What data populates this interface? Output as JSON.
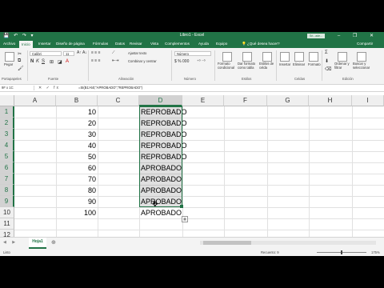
{
  "titlebar": {
    "quick_access": "💾 ↶ ↷ ▾",
    "title": "Libro1 - Excel",
    "user": "Sri...ade...",
    "window_controls": "– ❐ ✕"
  },
  "tabs": [
    "Archivo",
    "Inicio",
    "Insertar",
    "Diseño de página",
    "Fórmulas",
    "Datos",
    "Revisar",
    "Vista",
    "Complementos",
    "Ayuda",
    "Equipo"
  ],
  "tellme": "💡 ¿Qué desea hacer?",
  "share": "Compartir",
  "ribbon": {
    "paste": "Pegar",
    "clipboard": "Portapapeles",
    "font_name": "Calibri",
    "font_size": "11",
    "font_group": "Fuente",
    "wrap_text": "Ajustar texto",
    "merge": "Combinar y centrar",
    "alignment_group": "Alineación",
    "number_format": "Número",
    "number_group": "Número",
    "cond_format": "Formato condicional",
    "format_table": "Dar formato como tabla",
    "cell_styles": "Estilos de celda",
    "styles_group": "Estilos",
    "insert": "Insertar",
    "delete": "Eliminar",
    "format": "Formato",
    "cells_group": "Celdas",
    "sort": "Ordenar y filtrar",
    "find": "Buscar y seleccionar",
    "editing_group": "Edición"
  },
  "formula_bar": {
    "name_box": "9F x 1C",
    "fx": "✕ ✓ fx",
    "formula": "=SI(B1>50;\"APROBADO\";\"REPROBADO\")"
  },
  "columns": [
    "A",
    "B",
    "C",
    "D",
    "E",
    "F",
    "G",
    "H",
    "I"
  ],
  "rows": [
    "1",
    "2",
    "3",
    "4",
    "5",
    "6",
    "7",
    "8",
    "9",
    "10",
    "11",
    "12"
  ],
  "col_b": [
    "10",
    "20",
    "30",
    "40",
    "50",
    "60",
    "70",
    "80",
    "90",
    "100"
  ],
  "col_d": [
    "REPROBADO",
    "REPROBADO",
    "REPROBADO",
    "REPROBADO",
    "REPROBADO",
    "APROBADO",
    "APROBADO",
    "APROBADO",
    "APROBADO",
    "APROBADO"
  ],
  "sheet_tab": "Hoja1",
  "status": {
    "ready": "Listo",
    "summary": "Recuento: 9",
    "zoom": "175%"
  }
}
